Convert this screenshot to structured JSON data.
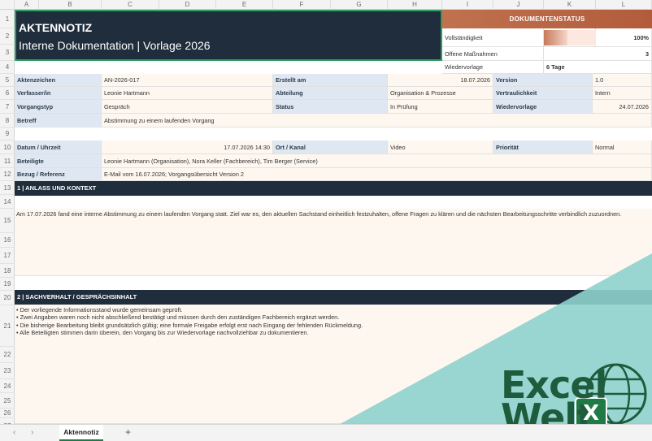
{
  "grid": {
    "columns": [
      "A",
      "B",
      "C",
      "D",
      "E",
      "F",
      "G",
      "H",
      "I",
      "J",
      "K",
      "L"
    ],
    "rows": [
      "1",
      "2",
      "3",
      "4",
      "5",
      "6",
      "7",
      "8",
      "9",
      "10",
      "11",
      "12",
      "13",
      "14",
      "15",
      "16",
      "17",
      "18",
      "19",
      "20",
      "21",
      "22",
      "23",
      "24",
      "25",
      "26",
      "27"
    ]
  },
  "title": {
    "line1": "AKTENNOTIZ",
    "line2": "Interne Dokumentation | Vorlage 2026"
  },
  "status": {
    "header": "DOKUMENTENSTATUS",
    "completeness_label": "Vollständigkeit",
    "completeness_value": "100%",
    "completeness_fraction": 0.45,
    "open_label": "Offene Maßnahmen",
    "open_value": "3",
    "followup_label": "Wiedervorlage",
    "followup_value": "6 Tage"
  },
  "meta": {
    "aktenzeichen_label": "Aktenzeichen",
    "aktenzeichen": "AN-2026-017",
    "erstellt_label": "Erstellt am",
    "erstellt": "18.07.2026",
    "version_label": "Version",
    "version": "1.0",
    "verfasser_label": "Verfasser/in",
    "verfasser": "Leonie Hartmann",
    "abteilung_label": "Abteilung",
    "abteilung": "Organisation & Prozesse",
    "vertraulichkeit_label": "Vertraulichkeit",
    "vertraulichkeit": "Intern",
    "vorgangstyp_label": "Vorgangstyp",
    "vorgangstyp": "Gespräch",
    "status_label": "Status",
    "status": "In Prüfung",
    "wiedervorlage_label": "Wiedervorlage",
    "wiedervorlage": "24.07.2026",
    "betreff_label": "Betreff",
    "betreff": "Abstimmung zu einem laufenden Vorgang"
  },
  "details": {
    "datum_label": "Datum / Uhrzeit",
    "datum": "17.07.2026 14:30",
    "ort_label": "Ort / Kanal",
    "ort": "Video",
    "prioritaet_label": "Priorität",
    "prioritaet": "Normal",
    "beteiligte_label": "Beteiligte",
    "beteiligte": "Leonie Hartmann (Organisation), Nora Keller (Fachbereich), Tim Berger (Service)",
    "bezug_label": "Bezug / Referenz",
    "bezug": "E-Mail vom 16.07.2026; Vorgangsübersicht Version 2"
  },
  "section1": {
    "header": "1  |  ANLASS UND KONTEXT",
    "text": "Am 17.07.2026 fand eine interne Abstimmung zu einem laufenden Vorgang statt. Ziel war es, den aktuellen Sachstand einheitlich festzuhalten, offene Fragen zu klären und die nächsten Bearbeitungsschritte verbindlich zuzuordnen."
  },
  "section2": {
    "header": "2  |  SACHVERHALT / GESPRÄCHSINHALT",
    "bullets": [
      "• Der vorliegende Informationsstand wurde gemeinsam geprüft.",
      "• Zwei Angaben waren noch nicht abschließend bestätigt und müssen durch den zuständigen Fachbereich ergänzt werden.",
      "• Die bisherige Bearbeitung bleibt grundsätzlich gültig; eine formale Freigabe erfolgt erst nach Eingang der fehlenden Rückmeldung.",
      "• Alle Beteiligten stimmen darin überein, den Vorgang bis zur Wiedervorlage nachvollziehbar zu dokumentieren."
    ]
  },
  "tabs": {
    "active": "Aktennotiz",
    "add": "+",
    "prev": "‹",
    "next": "›"
  },
  "logo": {
    "word1": "Excel",
    "word2": "Welt",
    "badge": "X"
  },
  "colors": {
    "navy": "#1f2d3d",
    "accent": "#c0714d",
    "green": "#1f7a45",
    "teal": "#8ed1cd"
  }
}
